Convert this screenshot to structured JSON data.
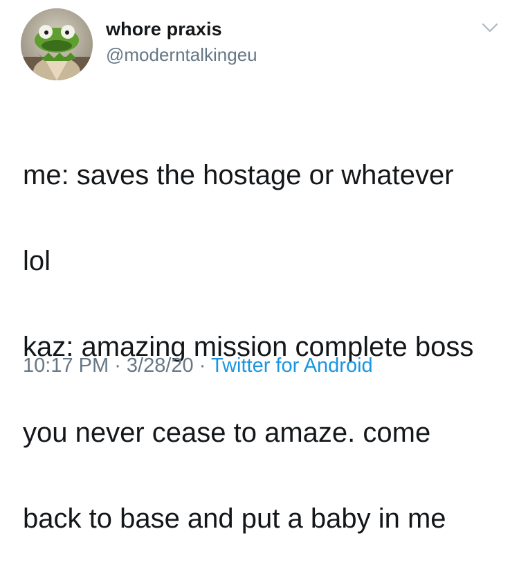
{
  "tweet": {
    "author": {
      "display_name": "whore praxis",
      "handle": "@moderntalkingeu",
      "avatar_icon": "kermit-frog-avatar"
    },
    "menu_icon": "chevron-down-icon",
    "text_lines": [
      "me: saves the hostage or whatever",
      "lol",
      "kaz: amazing mission complete boss",
      "you never cease to amaze. come",
      "back to base and put a baby in me"
    ],
    "meta": {
      "time": "10:17 PM",
      "separator": "·",
      "date": "3/28/20",
      "source": "Twitter for Android"
    },
    "colors": {
      "text": "#14171a",
      "secondary": "#657786",
      "link": "#1b95e0"
    }
  }
}
